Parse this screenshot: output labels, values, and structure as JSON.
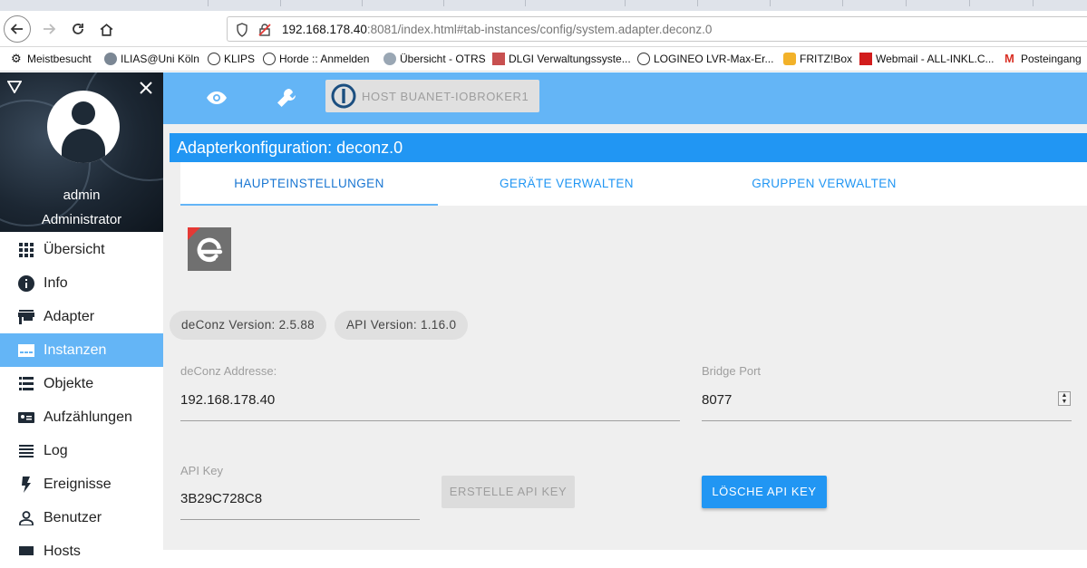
{
  "browser": {
    "url_host": "192.168.178.40",
    "url_rest": ":8081/index.html#tab-instances/config/system.adapter.deconz.0",
    "bookmarks": [
      {
        "label": "Meistbesucht",
        "icon": "gear-icon"
      },
      {
        "label": "ILIAS@Uni Köln",
        "icon": "ilias-icon"
      },
      {
        "label": "KLIPS",
        "icon": "globe-icon"
      },
      {
        "label": "Horde :: Anmelden",
        "icon": "globe-icon"
      },
      {
        "label": "Übersicht - OTRS",
        "icon": "otrs-icon"
      },
      {
        "label": "DLGI Verwaltungssyste...",
        "icon": "dlgi-icon"
      },
      {
        "label": "LOGINEO LVR-Max-Er...",
        "icon": "globe-icon"
      },
      {
        "label": "FRITZ!Box",
        "icon": "fritzbox-icon"
      },
      {
        "label": "Webmail - ALL-INKL.C...",
        "icon": "webmail-icon"
      },
      {
        "label": "Posteingang",
        "icon": "gmail-icon"
      }
    ]
  },
  "sidebar": {
    "username": "admin",
    "role": "Administrator",
    "items": [
      {
        "label": "Übersicht",
        "icon": "apps-grid-icon",
        "active": false
      },
      {
        "label": "Info",
        "icon": "info-icon",
        "active": false
      },
      {
        "label": "Adapter",
        "icon": "store-icon",
        "active": false
      },
      {
        "label": "Instanzen",
        "icon": "instances-icon",
        "active": true
      },
      {
        "label": "Objekte",
        "icon": "list-icon",
        "active": false
      },
      {
        "label": "Aufzählungen",
        "icon": "enum-icon",
        "active": false
      },
      {
        "label": "Log",
        "icon": "log-icon",
        "active": false
      },
      {
        "label": "Ereignisse",
        "icon": "flash-icon",
        "active": false
      },
      {
        "label": "Benutzer",
        "icon": "user-icon",
        "active": false
      },
      {
        "label": "Hosts",
        "icon": "hosts-icon",
        "active": false
      }
    ]
  },
  "topbar": {
    "host_label": "HOST BUANET-IOBROKER1"
  },
  "config": {
    "title": "Adapterkonfiguration: deconz.0",
    "tabs": [
      "HAUPTEINSTELLUNGEN",
      "GERÄTE VERWALTEN",
      "GRUPPEN VERWALTEN"
    ],
    "active_tab": "HAUPTEINSTELLUNGEN",
    "chips": [
      "deConz Version: 2.5.88",
      "API Version: 1.16.0"
    ],
    "address_label": "deConz Addresse:",
    "address_value": "192.168.178.40",
    "port_label": "Bridge Port",
    "port_value": "8077",
    "apikey_label": "API Key",
    "apikey_value": "3B29C728C8",
    "create_btn": "ERSTELLE API KEY",
    "delete_btn": "LÖSCHE API KEY"
  },
  "colors": {
    "accent": "#2196f3",
    "topbar": "#64b5f6",
    "active_menu": "#64b5f6"
  }
}
